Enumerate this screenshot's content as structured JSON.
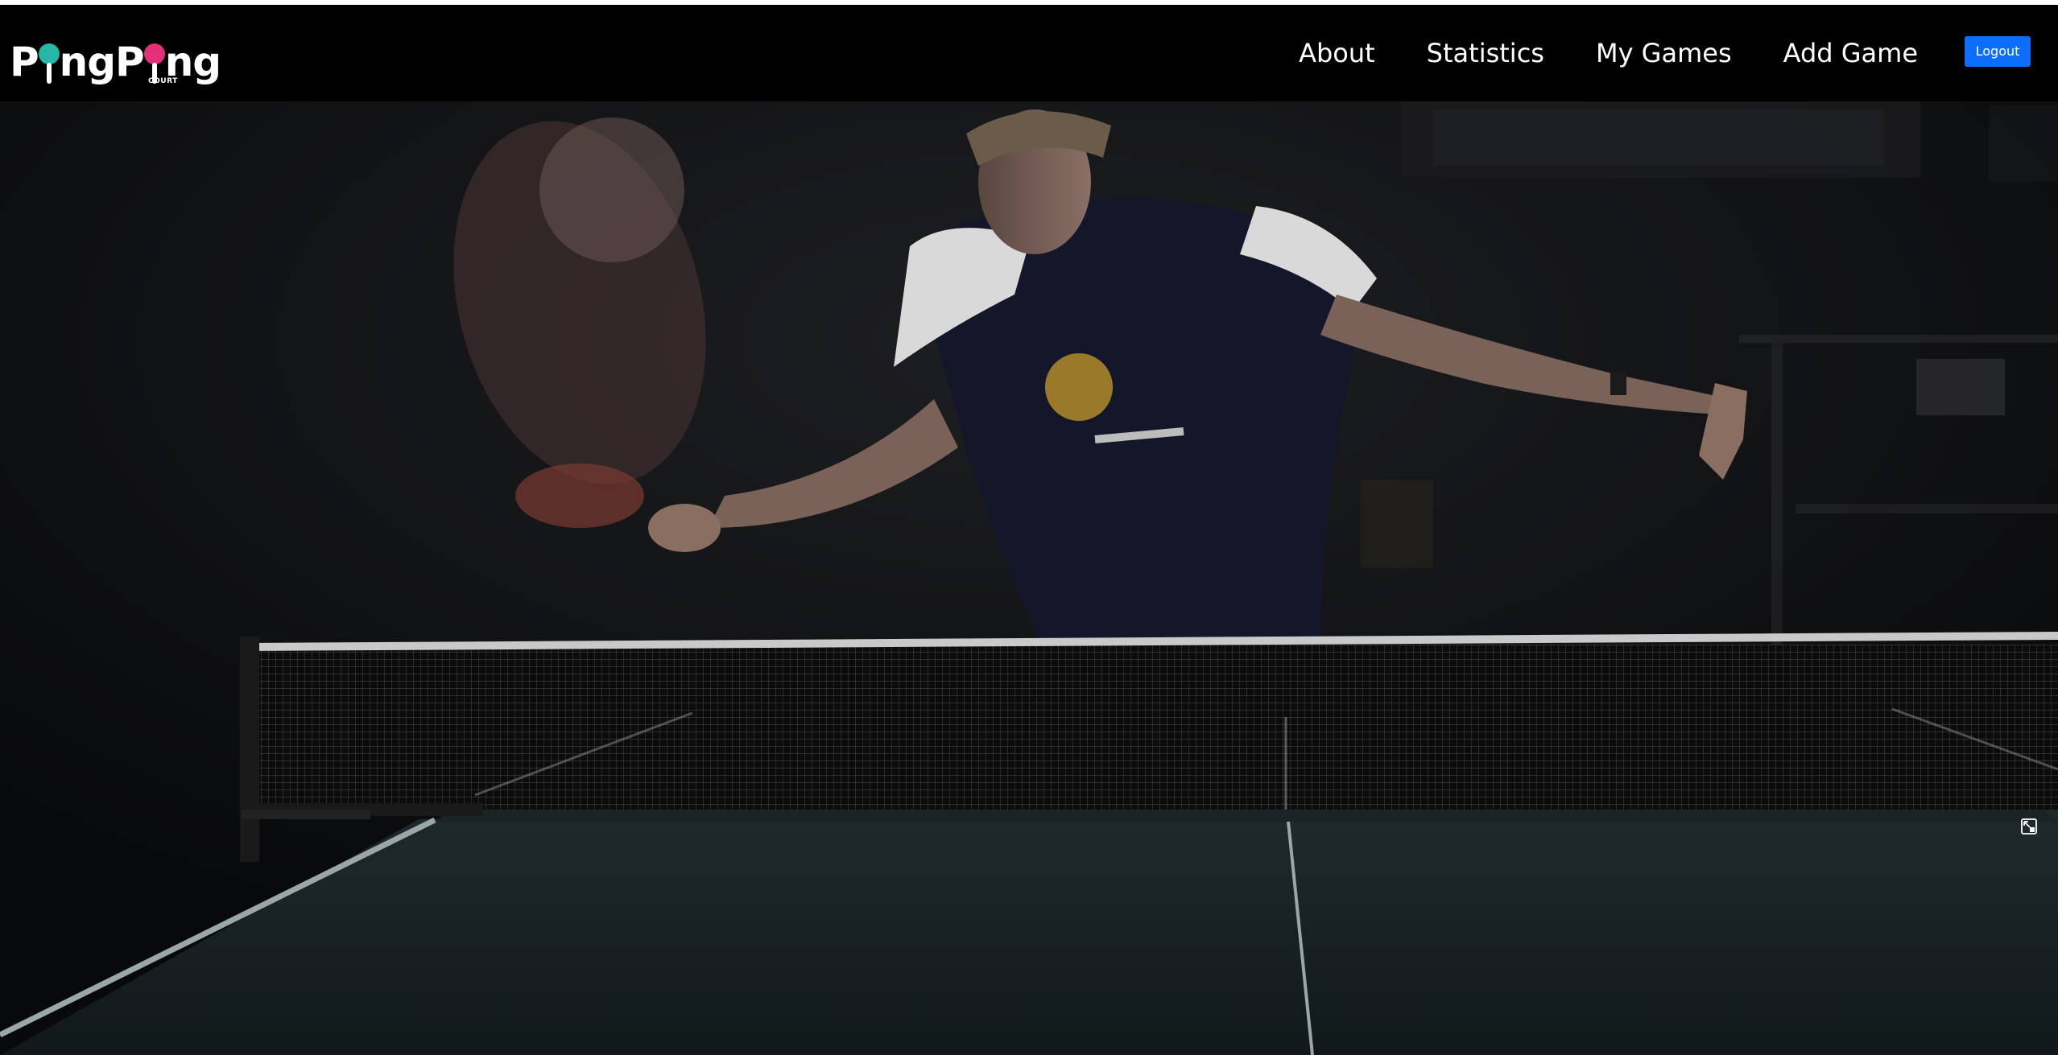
{
  "app": {
    "logo_text_left": "P",
    "logo_text_mid": "ngP",
    "logo_text_right": "ng",
    "logo_subtext": "COURT"
  },
  "nav": {
    "items": [
      {
        "label": "About"
      },
      {
        "label": "Statistics"
      },
      {
        "label": "My Games"
      },
      {
        "label": "Add Game"
      }
    ],
    "logout_label": "Logout"
  },
  "hero": {
    "image_subject": "table-tennis-player-hero-photo",
    "icon": "expand-icon"
  },
  "colors": {
    "navbar_bg": "#000000",
    "logout_bg": "#0d6efd",
    "logo_ball_teal": "#27b7a8",
    "logo_ball_pink": "#e4307a",
    "text": "#ffffff"
  }
}
